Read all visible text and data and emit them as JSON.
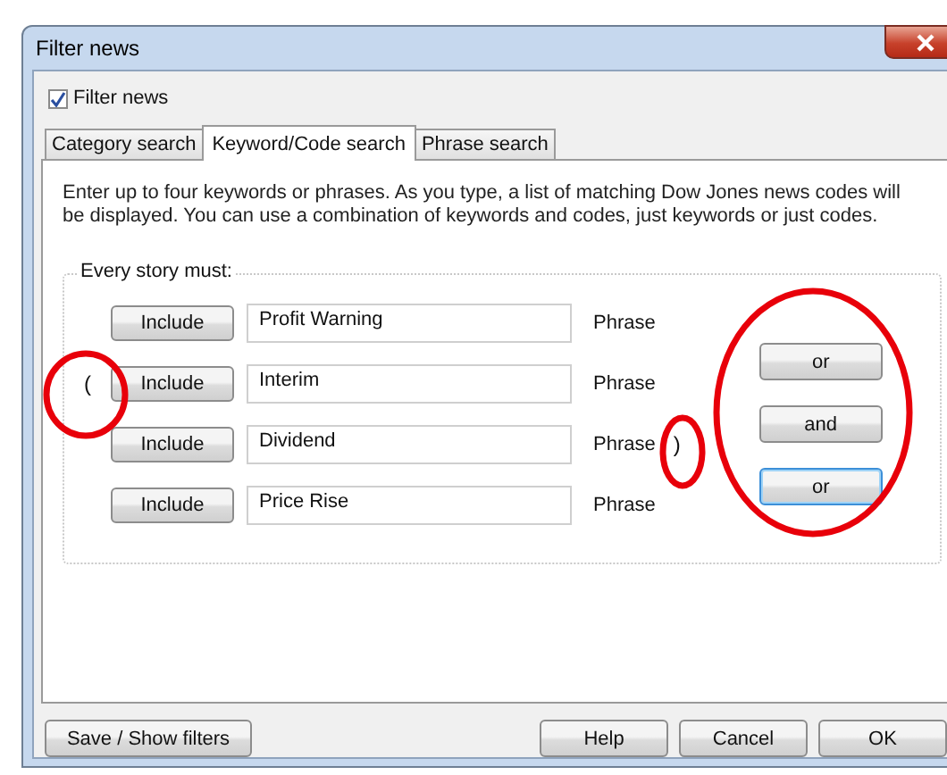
{
  "window": {
    "title": "Filter news"
  },
  "filter_checkbox": {
    "label": "Filter news",
    "checked": true
  },
  "tabs": [
    {
      "label": "Category search",
      "selected": false
    },
    {
      "label": "Keyword/Code search",
      "selected": true
    },
    {
      "label": "Phrase search",
      "selected": false
    }
  ],
  "intro": "Enter up to four keywords or phrases. As you type, a list of matching Dow Jones news codes will be displayed. You can use a combination of keywords and codes, just keywords or just codes.",
  "group": {
    "legend": "Every story must:"
  },
  "rows": [
    {
      "open_bracket": "",
      "button": "Include",
      "value": "Profit Warning",
      "type_label": "Phrase",
      "close_bracket": ""
    },
    {
      "open_bracket": "(",
      "button": "Include",
      "value": "Interim",
      "type_label": "Phrase",
      "close_bracket": ""
    },
    {
      "open_bracket": "",
      "button": "Include",
      "value": "Dividend",
      "type_label": "Phrase",
      "close_bracket": ")"
    },
    {
      "open_bracket": "",
      "button": "Include",
      "value": "Price Rise",
      "type_label": "Phrase",
      "close_bracket": ""
    }
  ],
  "connectors": [
    {
      "label": "or",
      "focused": false
    },
    {
      "label": "and",
      "focused": false
    },
    {
      "label": "or",
      "focused": true
    }
  ],
  "footer": {
    "left_button": "Save / Show filters",
    "buttons": [
      "Help",
      "Cancel",
      "OK"
    ]
  }
}
